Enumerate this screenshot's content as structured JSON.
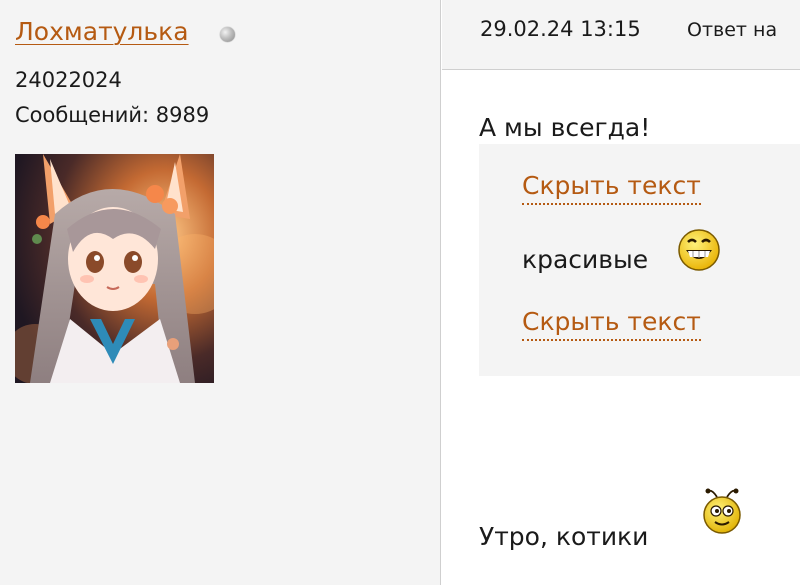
{
  "user": {
    "name": "Лохматулька",
    "reg_date": "24022024",
    "messages": "Сообщений: 8989"
  },
  "post": {
    "date": "29.02.24 13:15",
    "reply": "Ответ на",
    "line1": "А мы всегда!",
    "spoiler": {
      "toggle_top": "Скрыть текст",
      "text": "красивые",
      "toggle_bottom": "Скрыть текст"
    },
    "line2": "Утро, котики"
  },
  "colors": {
    "link": "#b55a12",
    "sidebar_bg": "#f4f4f4",
    "spoiler_bg": "#f4f4f4"
  },
  "icons": {
    "status": "offline-status-icon",
    "smiley1": "grin-smiley-icon",
    "smiley2": "bee-smiley-icon"
  }
}
